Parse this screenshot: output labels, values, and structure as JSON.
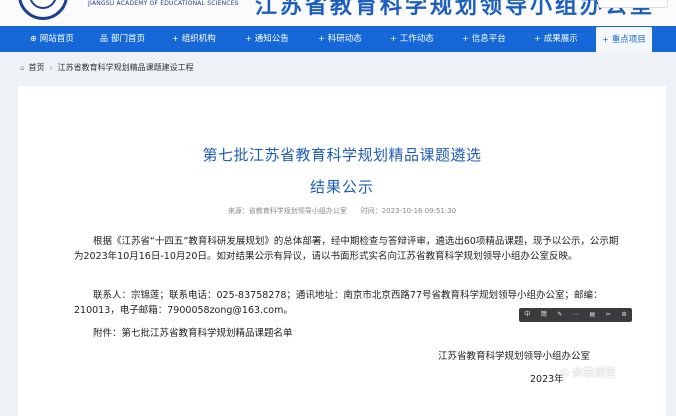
{
  "header": {
    "logo_text": "JIANGSU ACADEMY OF EDUCATIONAL SCIENCES",
    "banner_title": "江苏省教育科学规划领导小组办公室"
  },
  "nav": {
    "items": [
      {
        "label": "网站首页",
        "icon": "home-icon"
      },
      {
        "label": "部门首页",
        "icon": "sitemap-icon"
      },
      {
        "label": "组织机构",
        "icon": "plus-icon"
      },
      {
        "label": "通知公告",
        "icon": "plus-icon"
      },
      {
        "label": "科研动态",
        "icon": "plus-icon"
      },
      {
        "label": "工作动态",
        "icon": "plus-icon"
      },
      {
        "label": "信息平台",
        "icon": "plus-icon"
      },
      {
        "label": "成果展示",
        "icon": "plus-icon"
      },
      {
        "label": "重点项目",
        "icon": "plus-icon",
        "active": true
      }
    ]
  },
  "breadcrumb": {
    "home": "首页",
    "current": "江苏省教育科学规划精品课题建设工程"
  },
  "article": {
    "title_line1": "第七批江苏省教育科学规划精品课题遴选",
    "title_line2": "结果公示",
    "source": "来源：省教育科学规划领导小组办公室",
    "time": "时间：2023-10-16 09:51:30",
    "paragraph1": "根据《江苏省“十四五”教育科研发展规划》的总体部署，经中期检查与答辩评审，遴选出60项精品课题，现予以公示，公示期为2023年10月16日-10月20日。如对结果公示有异议，请以书面形式实名向江苏省教育科学规划领导小组办公室反映。",
    "paragraph2": "联系人：宗锦莲；联系电话：025-83758278；通讯地址：南京市北京西路77号省教育科学规划领导小组办公室；邮编：210013，电子邮箱：7900058zong@163.com。",
    "attachment": "附件：第七批江苏省教育科学规划精品课题名单",
    "signature": "江苏省教育科学规划领导小组办公室",
    "date": "2023年"
  },
  "toolbar": {
    "buttons": [
      "中",
      "簡",
      "✎",
      "⋯",
      "▤",
      "✂",
      "⚙"
    ]
  },
  "watermark": {
    "text": "余集课堂"
  },
  "colors": {
    "nav_bg": "#1668d9",
    "title": "#1f5db6",
    "page_bg": "#eef1f5"
  }
}
